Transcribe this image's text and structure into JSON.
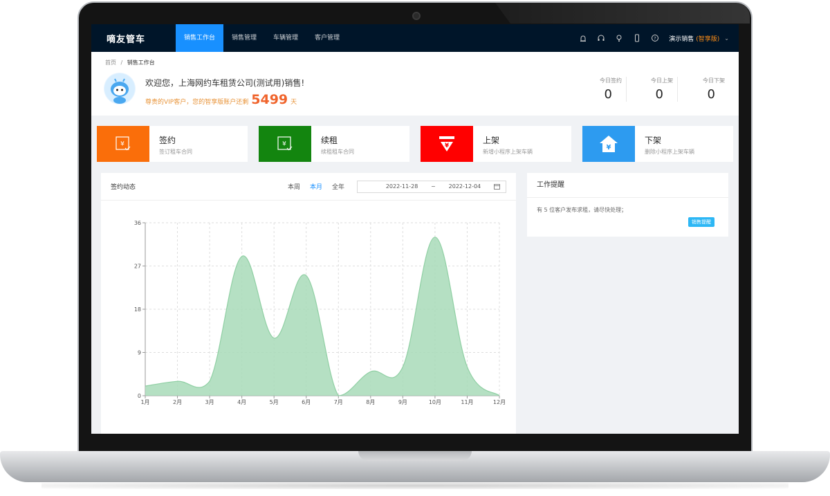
{
  "app": {
    "logo": "嘀友管车"
  },
  "nav": {
    "items": [
      "销售工作台",
      "销售管理",
      "车辆管理",
      "客户管理"
    ],
    "active_index": 0,
    "icons": [
      "alarm-icon",
      "headset-icon",
      "bulb-icon",
      "phone-icon",
      "help-icon"
    ],
    "user_name": "演示销售",
    "user_tier": "(智享版)"
  },
  "breadcrumb": {
    "home": "首页",
    "sep": "/",
    "current": "销售工作台"
  },
  "welcome": {
    "text": "欢迎您，上海网约车租赁公司(测试用)销售!",
    "vip_prefix": "尊贵的VIP客户，您的智享版账户还剩",
    "days": "5499",
    "days_unit": "天"
  },
  "stats": [
    {
      "label": "今日签约",
      "value": "0"
    },
    {
      "label": "今日上架",
      "value": "0"
    },
    {
      "label": "今日下架",
      "value": "0"
    }
  ],
  "actions": [
    {
      "title": "签约",
      "subtitle": "签订租车合同",
      "color": "#fa6e0a",
      "icon": "contract-yen-icon"
    },
    {
      "title": "续租",
      "subtitle": "续租租车合同",
      "color": "#13850f",
      "icon": "renew-yen-icon"
    },
    {
      "title": "上架",
      "subtitle": "新增小程序上架车辆",
      "color": "#ff0000",
      "icon": "yen-down-arrow-icon"
    },
    {
      "title": "下架",
      "subtitle": "删除小程序上架车辆",
      "color": "#2d9bf0",
      "icon": "house-yen-icon"
    }
  ],
  "chart_panel": {
    "title": "签约动态",
    "periods": [
      "本周",
      "本月",
      "全年"
    ],
    "active_period": 1,
    "date_start": "2022-11-28",
    "date_sep": "~",
    "date_end": "2022-12-04"
  },
  "reminder": {
    "title": "工作提醒",
    "text": "有 5 位客户发布求租，请尽快处理；",
    "badge": "销售提醒"
  },
  "chart_data": {
    "type": "area",
    "categories": [
      "1月",
      "2月",
      "3月",
      "4月",
      "5月",
      "6月",
      "7月",
      "8月",
      "9月",
      "10月",
      "11月",
      "12月"
    ],
    "values": [
      2,
      3,
      3,
      29,
      12,
      25,
      0,
      5,
      6,
      33,
      6,
      0
    ],
    "yticks": [
      0,
      9,
      18,
      27,
      36
    ],
    "ylim": [
      0,
      36
    ],
    "grid": true,
    "smooth": true,
    "fill_color": "#a8dbb8",
    "line_color": "#8fcfa3"
  }
}
